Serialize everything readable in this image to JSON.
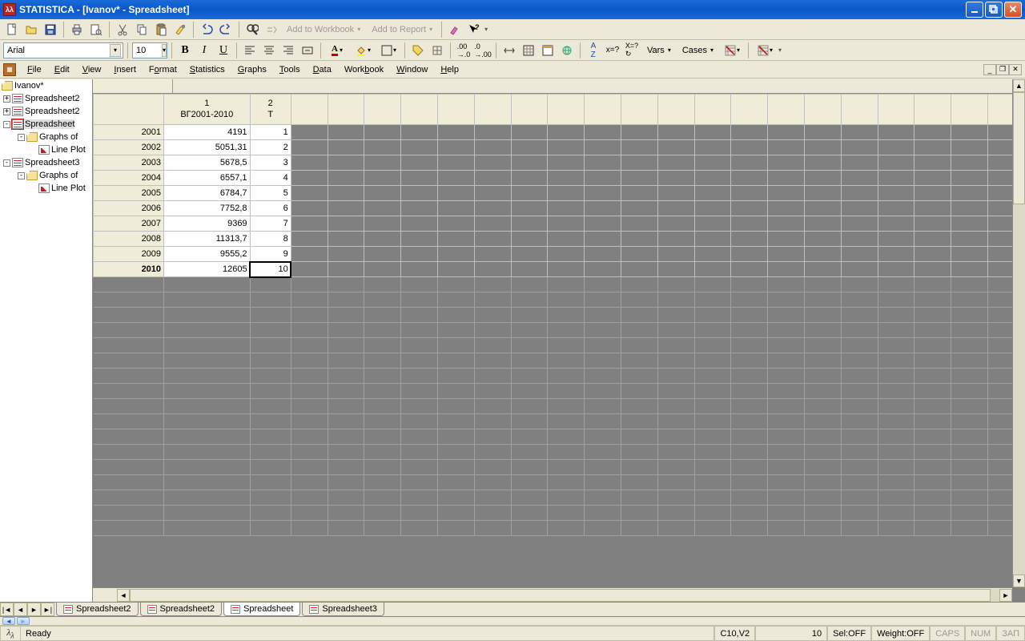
{
  "app": {
    "title": "STATISTICA - [Ivanov* - Spreadsheet]",
    "icon_label": "λλ"
  },
  "toolbar1": {
    "add_wb": "Add to Workbook",
    "add_rpt": "Add to Report"
  },
  "toolbar2": {
    "font": "Arial",
    "size": "10",
    "vars": "Vars",
    "cases": "Cases"
  },
  "menu": {
    "file": "File",
    "edit": "Edit",
    "view": "View",
    "insert": "Insert",
    "format": "Format",
    "statistics": "Statistics",
    "graphs": "Graphs",
    "tools": "Tools",
    "data": "Data",
    "workbook": "Workbook",
    "window": "Window",
    "help": "Help"
  },
  "tree": {
    "root": "Ivanov*",
    "n1": "Spreadsheet2",
    "n2": "Spreadsheet2",
    "n3": "Spreadsheet",
    "n3a": "Graphs of",
    "n3b": "Line Plot",
    "n4": "Spreadsheet3",
    "n4a": "Graphs of",
    "n4b": "Line Plot"
  },
  "columns": [
    {
      "num": "1",
      "name": "ВГ2001-2010"
    },
    {
      "num": "2",
      "name": "T"
    }
  ],
  "rows": [
    {
      "h": "2001",
      "v1": "4191",
      "v2": "1"
    },
    {
      "h": "2002",
      "v1": "5051,31",
      "v2": "2"
    },
    {
      "h": "2003",
      "v1": "5678,5",
      "v2": "3"
    },
    {
      "h": "2004",
      "v1": "6557,1",
      "v2": "4"
    },
    {
      "h": "2005",
      "v1": "6784,7",
      "v2": "5"
    },
    {
      "h": "2006",
      "v1": "7752,8",
      "v2": "6"
    },
    {
      "h": "2007",
      "v1": "9369",
      "v2": "7"
    },
    {
      "h": "2008",
      "v1": "11313,7",
      "v2": "8"
    },
    {
      "h": "2009",
      "v1": "9555,2",
      "v2": "9"
    },
    {
      "h": "2010",
      "v1": "12605",
      "v2": "10",
      "bold": true,
      "sel": true
    }
  ],
  "tabs": {
    "t1": "Spreadsheet2",
    "t2": "Spreadsheet2",
    "t3": "Spreadsheet",
    "t4": "Spreadsheet3"
  },
  "status": {
    "ready": "Ready",
    "cell": "C10,V2",
    "val": "10",
    "sel": "Sel:OFF",
    "weight": "Weight:OFF",
    "caps": "CAPS",
    "num": "NUM",
    "zap": "ЗАП"
  }
}
